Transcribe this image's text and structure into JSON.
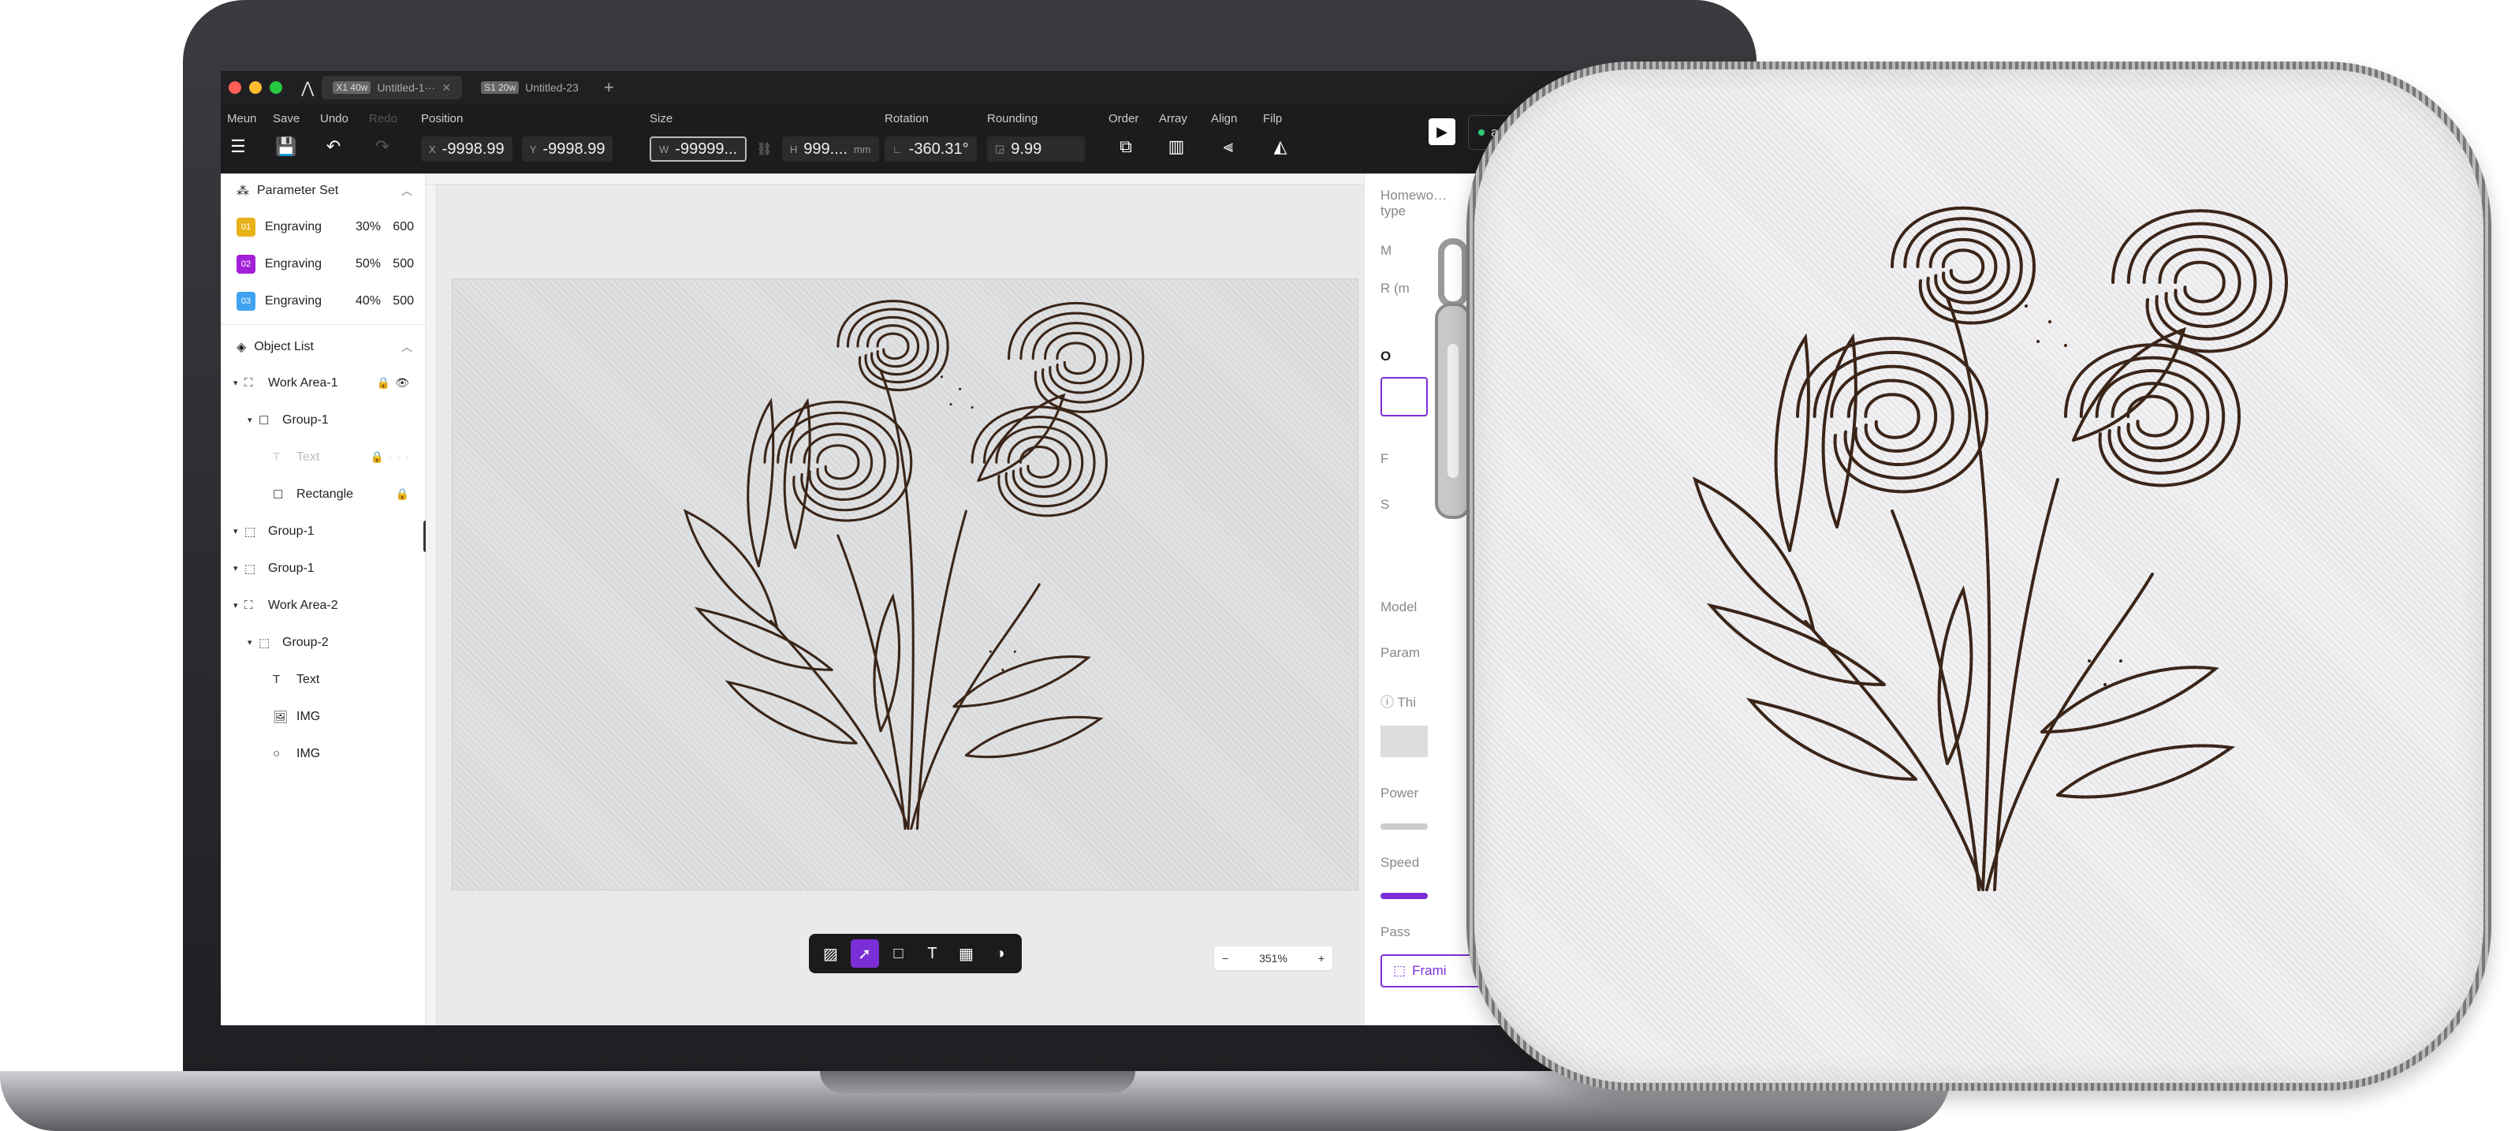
{
  "window": {
    "tabs": [
      {
        "badge": "X1 40w",
        "label": "Untitled-1···"
      },
      {
        "badge": "S1 20w",
        "label": "Untitled-23"
      }
    ],
    "add_tab": "+"
  },
  "toolbar": {
    "menu": "Meun",
    "save": "Save",
    "undo": "Undo",
    "redo": "Redo",
    "position_label": "Position",
    "x_prefix": "X",
    "x_value": "-9998.99",
    "y_prefix": "Y",
    "y_value": "-9998.99",
    "size_label": "Size",
    "w_prefix": "W",
    "w_value": "-99999...",
    "h_prefix": "H",
    "h_value": "999....",
    "unit": "mm",
    "rotation_label": "Rotation",
    "rotation_value": "-360.31°",
    "rounding_label": "Rounding",
    "rounding_value": "9.99",
    "order": "Order",
    "array": "Array",
    "align": "Align",
    "flip": "Filp",
    "device_name": "asda"
  },
  "parameter_set": {
    "title": "Parameter Set",
    "items": [
      {
        "chip": "01",
        "color": "#e8b21a",
        "name": "Engraving",
        "power": "30%",
        "speed": "600"
      },
      {
        "chip": "02",
        "color": "#a420d8",
        "name": "Engraving",
        "power": "50%",
        "speed": "500"
      },
      {
        "chip": "03",
        "color": "#3fa3f2",
        "name": "Engraving",
        "power": "40%",
        "speed": "500"
      }
    ]
  },
  "object_list": {
    "title": "Object List",
    "items": [
      {
        "label": "Work Area-1",
        "depth": 0,
        "tri": "▾",
        "icon": "workarea-icon",
        "glyph": "⛶",
        "tail": "🔒👁",
        "faded": false
      },
      {
        "label": "Group-1",
        "depth": 1,
        "tri": "▾",
        "icon": "group-icon",
        "glyph": "☐",
        "tail": "",
        "faded": false
      },
      {
        "label": "Text",
        "depth": 2,
        "tri": "",
        "icon": "text-icon",
        "glyph": "T",
        "tail": "🔒···",
        "faded": true
      },
      {
        "label": "Rectangle",
        "depth": 2,
        "tri": "",
        "icon": "rectangle-icon",
        "glyph": "☐",
        "tail": "🔒",
        "faded": false
      },
      {
        "label": "Group-1",
        "depth": 0,
        "tri": "▾",
        "icon": "group-icon",
        "glyph": "⬚",
        "tail": "",
        "faded": false
      },
      {
        "label": "Group-1",
        "depth": 0,
        "tri": "▾",
        "icon": "group-icon",
        "glyph": "⬚",
        "tail": "",
        "faded": false
      },
      {
        "label": "Work Area-2",
        "depth": 0,
        "tri": "▾",
        "icon": "workarea-icon",
        "glyph": "⛶",
        "tail": "",
        "faded": false
      },
      {
        "label": "Group-2",
        "depth": 1,
        "tri": "▾",
        "icon": "group-icon",
        "glyph": "⬚",
        "tail": "",
        "faded": false
      },
      {
        "label": "Text",
        "depth": 2,
        "tri": "",
        "icon": "text-icon",
        "glyph": "T",
        "tail": "",
        "faded": false
      },
      {
        "label": "IMG",
        "depth": 2,
        "tri": "",
        "icon": "image-icon",
        "glyph": "🖼",
        "tail": "",
        "faded": false
      },
      {
        "label": "IMG",
        "depth": 2,
        "tri": "",
        "icon": "circle-icon",
        "glyph": "○",
        "tail": "",
        "faded": false
      }
    ]
  },
  "canvas": {
    "zoom": "351%",
    "zoom_minus": "−",
    "zoom_plus": "+"
  },
  "right_panel": {
    "homework_type": "Homewo… type",
    "m_label": "M",
    "r_label": "R (m",
    "o_label": "O",
    "f_label": "F",
    "s_label": "S",
    "model": "Model",
    "param": "Param",
    "this": "Thi",
    "power": "Power",
    "speed": "Speed",
    "pass": "Pass",
    "framing": "Frami"
  },
  "colors": {
    "accent": "#7b2ed6",
    "engrave": "#3a2518"
  }
}
